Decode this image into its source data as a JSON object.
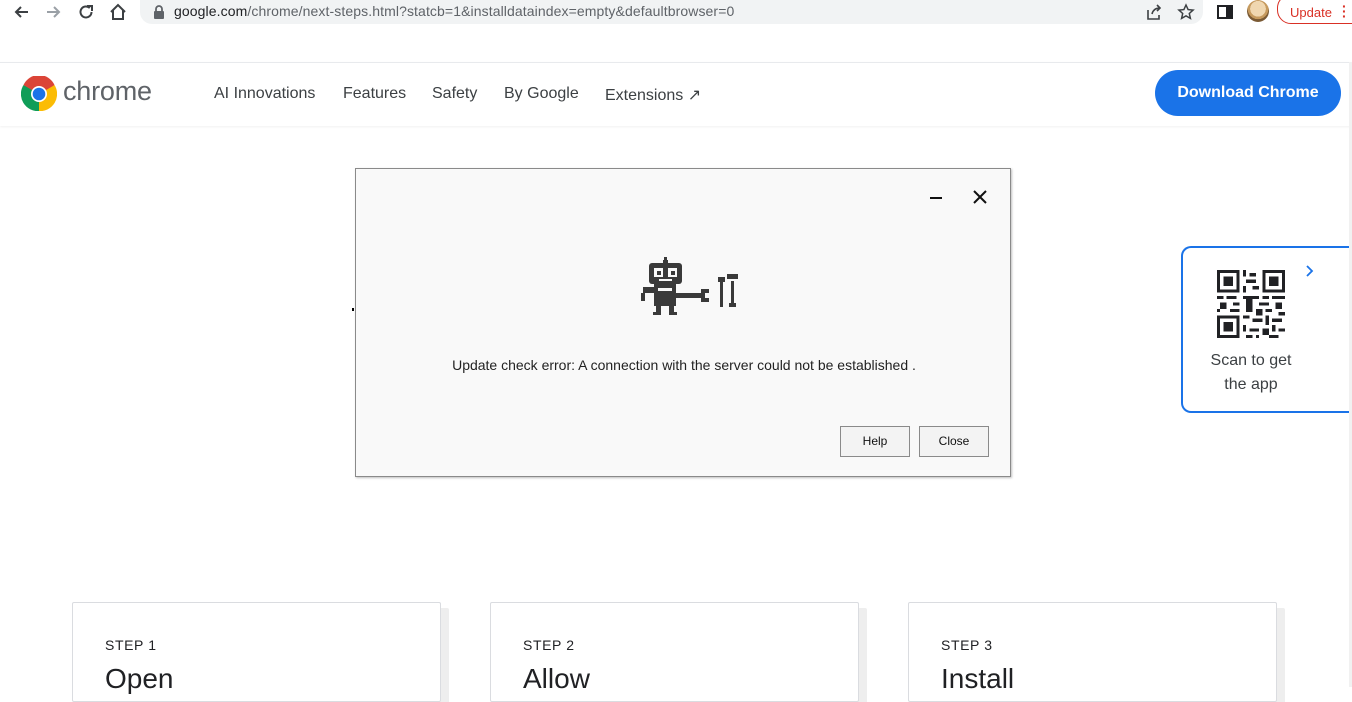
{
  "browser": {
    "url_host": "google.com",
    "url_rest": "/chrome/next-steps.html?statcb=1&installdataindex=empty&defaultbrowser=0",
    "update_label": "Update"
  },
  "site": {
    "logo_text": "chrome",
    "nav": [
      "AI Innovations",
      "Features",
      "Safety",
      "By Google",
      "Extensions ↗"
    ],
    "download_label": "Download Chrome"
  },
  "dialog": {
    "message": "Update check error: A connection with the server could not be established .",
    "help_label": "Help",
    "close_label": "Close"
  },
  "qr_card": {
    "line1": "Scan to get",
    "line2": "the app"
  },
  "steps": [
    {
      "label": "STEP 1",
      "title": "Open"
    },
    {
      "label": "STEP 2",
      "title": "Allow"
    },
    {
      "label": "STEP 3",
      "title": "Install"
    }
  ],
  "colors": {
    "accent": "#1a73e8",
    "update_red": "#d93025"
  }
}
